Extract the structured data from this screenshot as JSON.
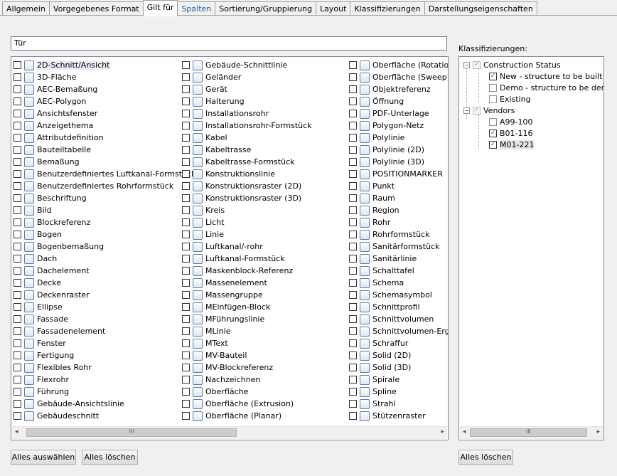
{
  "tabs": [
    "Allgemein",
    "Vorgegebenes Format",
    "Gilt für",
    "Spalten",
    "Sortierung/Gruppierung",
    "Layout",
    "Klassifizierungen",
    "Darstellungseigenschaften"
  ],
  "active_tab_index": 2,
  "filter_value": "Tür",
  "object_types": {
    "column1": [
      {
        "label": "2D-Schnitt/Ansicht",
        "icon": "2d-section-icon"
      },
      {
        "label": "3D-Fläche",
        "icon": "3d-face-icon"
      },
      {
        "label": "AEC-Bemaßung",
        "icon": "aec-dimension-icon"
      },
      {
        "label": "AEC-Polygon",
        "icon": "aec-polygon-icon"
      },
      {
        "label": "Ansichtsfenster",
        "icon": "viewport-icon"
      },
      {
        "label": "Anzeigethema",
        "icon": "display-theme-icon"
      },
      {
        "label": "Attributdefinition",
        "icon": "attribute-definition-icon"
      },
      {
        "label": "Bauteiltabelle",
        "icon": "schedule-table-icon"
      },
      {
        "label": "Bemaßung",
        "icon": "dimension-icon"
      },
      {
        "label": "Benutzerdefiniertes Luftkanal-Formstück",
        "icon": "custom-duct-fitting-icon"
      },
      {
        "label": "Benutzerdefiniertes Rohrformstück",
        "icon": "custom-pipe-fitting-icon"
      },
      {
        "label": "Beschriftung",
        "icon": "label-icon"
      },
      {
        "label": "Bild",
        "icon": "image-icon"
      },
      {
        "label": "Blockreferenz",
        "icon": "block-reference-icon"
      },
      {
        "label": "Bogen",
        "icon": "arc-icon"
      },
      {
        "label": "Bogenbemaßung",
        "icon": "arc-dimension-icon"
      },
      {
        "label": "Dach",
        "icon": "roof-icon"
      },
      {
        "label": "Dachelement",
        "icon": "roof-slab-icon"
      },
      {
        "label": "Decke",
        "icon": "slab-icon"
      },
      {
        "label": "Deckenraster",
        "icon": "ceiling-grid-icon"
      },
      {
        "label": "Ellipse",
        "icon": "ellipse-icon"
      },
      {
        "label": "Fassade",
        "icon": "curtain-wall-icon"
      },
      {
        "label": "Fassadenelement",
        "icon": "curtain-wall-unit-icon"
      },
      {
        "label": "Fenster",
        "icon": "window-icon"
      },
      {
        "label": "Fertigung",
        "icon": "fabrication-icon"
      },
      {
        "label": "Flexibles Rohr",
        "icon": "flexible-pipe-icon"
      },
      {
        "label": "Flexrohr",
        "icon": "flex-duct-icon"
      },
      {
        "label": "Führung",
        "icon": "leader-icon"
      },
      {
        "label": "Gebäude-Ansichtslinie",
        "icon": "building-elevation-line-icon"
      },
      {
        "label": "Gebäudeschnitt",
        "icon": "building-section-icon"
      }
    ],
    "column2": [
      {
        "label": "Gebäude-Schnittlinie",
        "icon": "building-section-line-icon"
      },
      {
        "label": "Geländer",
        "icon": "railing-icon"
      },
      {
        "label": "Gerät",
        "icon": "device-icon"
      },
      {
        "label": "Halterung",
        "icon": "hanger-icon"
      },
      {
        "label": "Installationsrohr",
        "icon": "conduit-icon"
      },
      {
        "label": "Installationsrohr-Formstück",
        "icon": "conduit-fitting-icon"
      },
      {
        "label": "Kabel",
        "icon": "wire-icon"
      },
      {
        "label": "Kabeltrasse",
        "icon": "cable-tray-icon"
      },
      {
        "label": "Kabeltrasse-Formstück",
        "icon": "cable-tray-fitting-icon"
      },
      {
        "label": "Konstruktionslinie",
        "icon": "construction-line-icon"
      },
      {
        "label": "Konstruktionsraster (2D)",
        "icon": "column-grid-2d-icon"
      },
      {
        "label": "Konstruktionsraster (3D)",
        "icon": "column-grid-3d-icon"
      },
      {
        "label": "Kreis",
        "icon": "circle-icon"
      },
      {
        "label": "Licht",
        "icon": "light-icon"
      },
      {
        "label": "Linie",
        "icon": "line-icon"
      },
      {
        "label": "Luftkanal/-rohr",
        "icon": "duct-icon"
      },
      {
        "label": "Luftkanal-Formstück",
        "icon": "duct-fitting-icon"
      },
      {
        "label": "Maskenblock-Referenz",
        "icon": "mask-block-icon"
      },
      {
        "label": "Massenelement",
        "icon": "mass-element-icon"
      },
      {
        "label": "Massengruppe",
        "icon": "mass-group-icon"
      },
      {
        "label": "MEinfügen-Block",
        "icon": "minsert-block-icon"
      },
      {
        "label": "MFührungslinie",
        "icon": "mleader-icon"
      },
      {
        "label": "MLinie",
        "icon": "mline-icon"
      },
      {
        "label": "MText",
        "icon": "mtext-icon"
      },
      {
        "label": "MV-Bauteil",
        "icon": "mv-part-icon"
      },
      {
        "label": "MV-Blockreferenz",
        "icon": "mv-block-icon"
      },
      {
        "label": "Nachzeichnen",
        "icon": "trace-icon"
      },
      {
        "label": "Oberfläche",
        "icon": "surface-icon"
      },
      {
        "label": "Oberfläche (Extrusion)",
        "icon": "surface-extrusion-icon"
      },
      {
        "label": "Oberfläche (Planar)",
        "icon": "surface-planar-icon"
      }
    ],
    "column3": [
      {
        "label": "Oberfläche (Rotation)",
        "icon": "surface-revolve-icon"
      },
      {
        "label": "Oberfläche (Sweep)",
        "icon": "surface-sweep-icon"
      },
      {
        "label": "Objektreferenz",
        "icon": "object-reference-icon"
      },
      {
        "label": "Öffnung",
        "icon": "opening-icon"
      },
      {
        "label": "PDF-Unterlage",
        "icon": "pdf-underlay-icon"
      },
      {
        "label": "Polygon-Netz",
        "icon": "polygon-mesh-icon"
      },
      {
        "label": "Polylinie",
        "icon": "polyline-icon"
      },
      {
        "label": "Polylinie (2D)",
        "icon": "polyline-2d-icon"
      },
      {
        "label": "Polylinie (3D)",
        "icon": "polyline-3d-icon"
      },
      {
        "label": "POSITIONMARKER",
        "icon": "position-marker-icon"
      },
      {
        "label": "Punkt",
        "icon": "point-icon"
      },
      {
        "label": "Raum",
        "icon": "space-icon"
      },
      {
        "label": "Region",
        "icon": "region-icon"
      },
      {
        "label": "Rohr",
        "icon": "pipe-icon"
      },
      {
        "label": "Rohrformstück",
        "icon": "pipe-fitting-icon"
      },
      {
        "label": "Sanitärformstück",
        "icon": "plumbing-fitting-icon"
      },
      {
        "label": "Sanitärlinie",
        "icon": "plumbing-line-icon"
      },
      {
        "label": "Schalttafel",
        "icon": "panel-icon"
      },
      {
        "label": "Schema",
        "icon": "schematic-icon"
      },
      {
        "label": "Schemasymbol",
        "icon": "schematic-symbol-icon"
      },
      {
        "label": "Schnittprofil",
        "icon": "section-profile-icon"
      },
      {
        "label": "Schnittvolumen",
        "icon": "section-volume-icon"
      },
      {
        "label": "Schnittvolumen-Ergeb",
        "icon": "section-volume-result-icon"
      },
      {
        "label": "Schraffur",
        "icon": "hatch-icon"
      },
      {
        "label": "Solid (2D)",
        "icon": "solid-2d-icon"
      },
      {
        "label": "Solid (3D)",
        "icon": "solid-3d-icon"
      },
      {
        "label": "Spirale",
        "icon": "helix-icon"
      },
      {
        "label": "Spline",
        "icon": "spline-icon"
      },
      {
        "label": "Strahl",
        "icon": "ray-icon"
      },
      {
        "label": "Stützenraster",
        "icon": "column-grid-icon"
      }
    ]
  },
  "buttons": {
    "select_all": "Alles auswählen",
    "clear_all": "Alles löschen",
    "clear_all_right": "Alles löschen"
  },
  "classifications": {
    "label": "Klassifizierungen:",
    "groups": [
      {
        "name": "Construction Status",
        "expander": "−",
        "items": [
          {
            "label": "New - structure to be built",
            "checked": true
          },
          {
            "label": "Demo - structure to be demolis",
            "checked": false
          },
          {
            "label": "Existing",
            "checked": false
          }
        ]
      },
      {
        "name": "Vendors",
        "expander": "−",
        "items": [
          {
            "label": "A99-100",
            "checked": false
          },
          {
            "label": "B01-116",
            "checked": true
          },
          {
            "label": "M01-221",
            "checked": true
          }
        ]
      }
    ]
  },
  "scrollbar": {
    "left_arrow": "◂",
    "right_arrow": "▸",
    "grip": "III"
  },
  "colors": {
    "check": "#1a8a1a",
    "tab_active_text": "#1e5aa0",
    "border": "#828790"
  }
}
